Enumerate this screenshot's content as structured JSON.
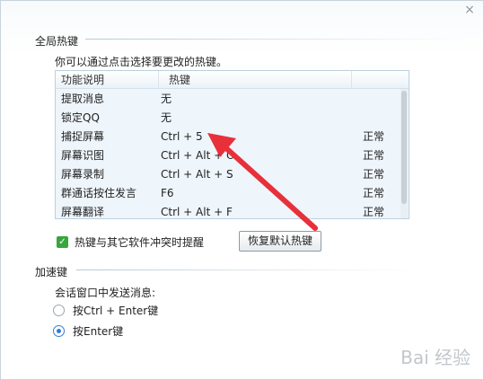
{
  "window": {
    "close_glyph": "×"
  },
  "global_hotkeys": {
    "section_title": "全局热键",
    "hint": "你可以通过点击选择要更改的热键。",
    "table": {
      "headers": [
        "功能说明",
        "热键",
        ""
      ],
      "rows": [
        {
          "name": "提取消息",
          "key": "无",
          "status": ""
        },
        {
          "name": "锁定QQ",
          "key": "无",
          "status": ""
        },
        {
          "name": "捕捉屏幕",
          "key": "Ctrl + 5",
          "status": "正常"
        },
        {
          "name": "屏幕识图",
          "key": "Ctrl + Alt + O",
          "status": "正常"
        },
        {
          "name": "屏幕录制",
          "key": "Ctrl + Alt + S",
          "status": "正常"
        },
        {
          "name": "群通话按住发言",
          "key": "F6",
          "status": "正常"
        },
        {
          "name": "屏幕翻译",
          "key": "Ctrl + Alt + F",
          "status": "正常"
        }
      ]
    },
    "conflict_checkbox": {
      "label": "热键与其它软件冲突时提醒",
      "checked": true
    },
    "restore_button": "恢复默认热键"
  },
  "accelerator": {
    "section_title": "加速键",
    "send_label": "会话窗口中发送消息:",
    "options": [
      {
        "label": "按Ctrl + Enter键",
        "checked": false
      },
      {
        "label": "按Enter键",
        "checked": true
      }
    ]
  },
  "colors": {
    "accent": "#2f7ed8",
    "checkbox": "#38a63d",
    "annotation_arrow": "#e8303a"
  },
  "watermark": "Bai 经验"
}
